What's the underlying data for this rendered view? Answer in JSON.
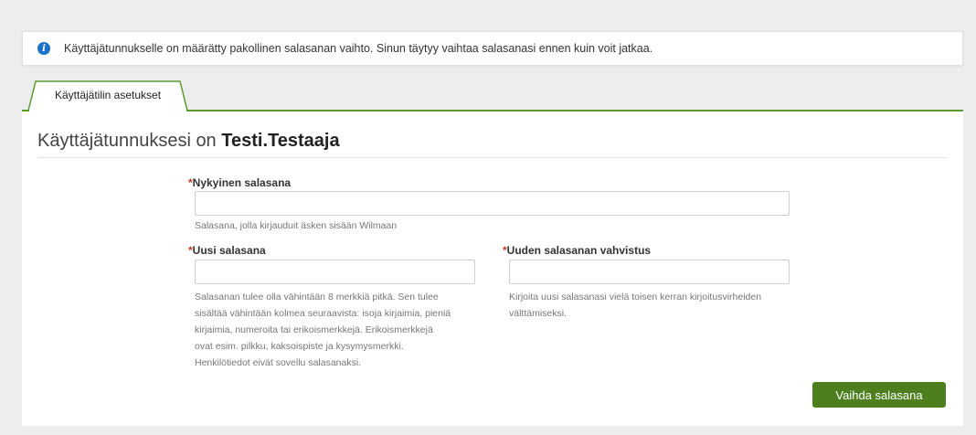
{
  "alert": {
    "icon": "info-icon",
    "icon_glyph": "i",
    "message": "Käyttäjätunnukselle on määrätty pakollinen salasanan vaihto. Sinun täytyy vaihtaa salasanasi ennen kuin voit jatkaa.",
    "icon_color": "#1a73c8"
  },
  "tabs": [
    {
      "label": "Käyttäjätilin asetukset",
      "active": true
    }
  ],
  "page": {
    "title_prefix": "Käyttäjätunnuksesi on",
    "username": "Testi.Testaaja"
  },
  "form": {
    "required_marker": "*",
    "current_password": {
      "label": "Nykyinen salasana",
      "value": "",
      "help": "Salasana, jolla kirjauduit äsken sisään Wilmaan"
    },
    "new_password": {
      "label": "Uusi salasana",
      "value": "",
      "help_lines": [
        "Salasanan tulee olla vähintään 8 merkkiä pitkä. Sen tulee",
        "sisältää vähintään kolmea seuraavista: isoja kirjaimia, pieniä",
        "kirjaimia, numeroita tai erikoismerkkejä. Erikoismerkkejä",
        "ovat esim. pilkku, kaksoispiste ja kysymysmerkki.",
        "Henkilötiedot eivät sovellu salasanaksi."
      ]
    },
    "confirm_password": {
      "label": "Uuden salasanan vahvistus",
      "value": "",
      "help_lines": [
        "Kirjoita uusi salasanasi vielä toisen kerran kirjoitusvirheiden",
        "välttämiseksi."
      ]
    },
    "submit_label": "Vaihda salasana"
  },
  "colors": {
    "accent_green": "#5a9a2e",
    "button_green": "#4d7f1f",
    "required_red": "#c0392b"
  }
}
